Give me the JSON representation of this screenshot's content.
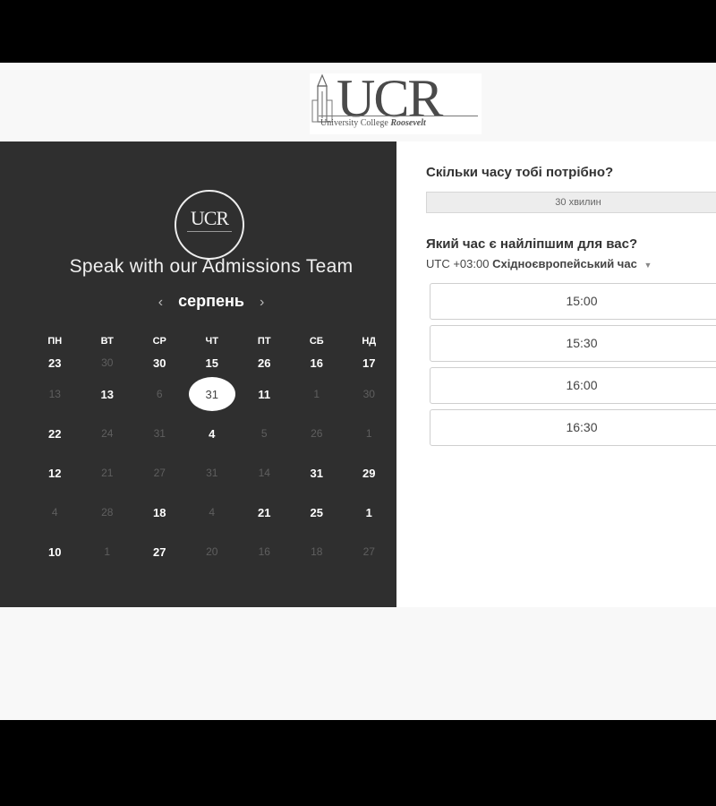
{
  "logo": {
    "letters": "UCR",
    "subtitle_first": "University College",
    "subtitle_last": "Roosevelt"
  },
  "left_panel": {
    "badge_letters": "UCR",
    "title": "Speak with our Admissions Team",
    "month": "серпень",
    "prev_icon": "chevron-left-icon",
    "next_icon": "chevron-right-icon",
    "weekdays": [
      "ПН",
      "ВТ",
      "СР",
      "ЧТ",
      "ПТ",
      "СБ",
      "НД"
    ],
    "weeks": [
      [
        {
          "d": "23",
          "s": "en"
        },
        {
          "d": "30",
          "s": "dis"
        },
        {
          "d": "30",
          "s": "en"
        },
        {
          "d": "15",
          "s": "en"
        },
        {
          "d": "26",
          "s": "en"
        },
        {
          "d": "16",
          "s": "en"
        },
        {
          "d": "17",
          "s": "en"
        }
      ],
      [
        {
          "d": "13",
          "s": "dis"
        },
        {
          "d": "13",
          "s": "en"
        },
        {
          "d": "6",
          "s": "dis"
        },
        {
          "d": "31",
          "s": "sel"
        },
        {
          "d": "11",
          "s": "en"
        },
        {
          "d": "1",
          "s": "dis"
        },
        {
          "d": "30",
          "s": "dis"
        }
      ],
      [
        {
          "d": "22",
          "s": "en"
        },
        {
          "d": "24",
          "s": "dis"
        },
        {
          "d": "31",
          "s": "dis"
        },
        {
          "d": "4",
          "s": "en"
        },
        {
          "d": "5",
          "s": "dis"
        },
        {
          "d": "26",
          "s": "dis"
        },
        {
          "d": "1",
          "s": "dis"
        }
      ],
      [
        {
          "d": "12",
          "s": "en"
        },
        {
          "d": "21",
          "s": "dis"
        },
        {
          "d": "27",
          "s": "dis"
        },
        {
          "d": "31",
          "s": "dis"
        },
        {
          "d": "14",
          "s": "dis"
        },
        {
          "d": "31",
          "s": "en"
        },
        {
          "d": "29",
          "s": "en"
        }
      ],
      [
        {
          "d": "4",
          "s": "dis"
        },
        {
          "d": "28",
          "s": "dis"
        },
        {
          "d": "18",
          "s": "en"
        },
        {
          "d": "4",
          "s": "dis"
        },
        {
          "d": "21",
          "s": "en"
        },
        {
          "d": "25",
          "s": "en"
        },
        {
          "d": "1",
          "s": "en"
        }
      ],
      [
        {
          "d": "10",
          "s": "en"
        },
        {
          "d": "1",
          "s": "dis"
        },
        {
          "d": "27",
          "s": "en"
        },
        {
          "d": "20",
          "s": "dis"
        },
        {
          "d": "16",
          "s": "dis"
        },
        {
          "d": "18",
          "s": "dis"
        },
        {
          "d": "27",
          "s": "dis"
        }
      ]
    ]
  },
  "right_panel": {
    "duration_question": "Скільки часу тобі потрібно?",
    "duration_value": "30 хвилин",
    "time_question": "Який час є найліпшим для вас?",
    "tz_offset": "UTC +03:00",
    "tz_name": "Східноєвропейський час",
    "tz_icon": "caret-down-icon",
    "slots": [
      "15:00",
      "15:30",
      "16:00",
      "16:30"
    ]
  },
  "colors": {
    "left_bg": "#2f2f2f",
    "page_bg": "#f8f8f8",
    "frame": "#000000"
  }
}
